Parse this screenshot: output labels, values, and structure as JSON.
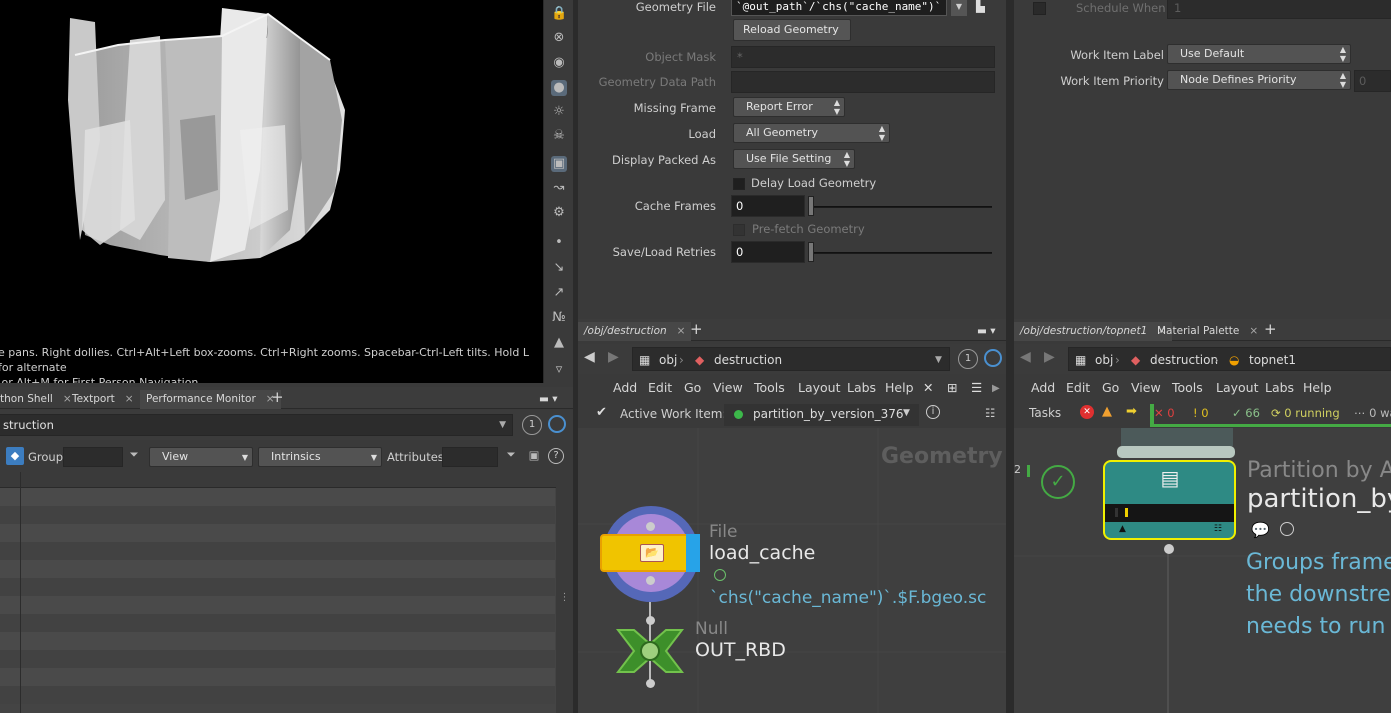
{
  "viewport": {
    "hint_text": "e pans. Right dollies. Ctrl+Alt+Left box-zooms. Ctrl+Right zooms. Spacebar-Ctrl-Left tilts. Hold L for alternate\n or Alt+M for First Person Navigation."
  },
  "lower_left": {
    "tabs": [
      {
        "label": "thon Shell"
      },
      {
        "label": "Textport"
      },
      {
        "label": "Performance Monitor"
      }
    ],
    "path_value": "struction",
    "group_label": "Group:",
    "view_label": "View",
    "intrinsics_label": "Intrinsics",
    "attributes_label": "Attributes:",
    "badge": "1"
  },
  "params": {
    "geometry_file_label": "Geometry File",
    "geometry_file_value": "`@out_path`/`chs(\"cache_name\")`",
    "reload_label": "Reload Geometry",
    "object_mask_label": "Object Mask",
    "object_mask_value": "*",
    "geo_data_path_label": "Geometry Data Path",
    "missing_frame_label": "Missing Frame",
    "missing_frame_value": "Report Error",
    "load_label": "Load",
    "load_value": "All Geometry",
    "display_packed_label": "Display Packed As",
    "display_packed_value": "Use File Setting",
    "delay_load_label": "Delay Load Geometry",
    "cache_frames_label": "Cache Frames",
    "cache_frames_value": "0",
    "prefetch_label": "Pre-fetch Geometry",
    "retries_label": "Save/Load Retries",
    "retries_value": "0"
  },
  "right_params": {
    "schedule_when_label": "Schedule When",
    "schedule_when_value": "1",
    "work_item_label_label": "Work Item Label",
    "work_item_label_value": "Use Default",
    "work_item_priority_label": "Work Item Priority",
    "work_item_priority_value": "Node Defines Priority",
    "priority_num": "0"
  },
  "mid_network": {
    "tab_label": "/obj/destruction",
    "crumb_obj": "obj",
    "crumb_dest": "destruction",
    "badge": "1",
    "menu": [
      "Add",
      "Edit",
      "Go",
      "View",
      "Tools",
      "Layout",
      "Labs",
      "Help"
    ],
    "active_work_item_label": "Active Work Item:",
    "active_work_item_value": "partition_by_version_376",
    "context_label": "Geometry",
    "node1_type": "File",
    "node1_name": "load_cache",
    "node1_comment": "`chs(\"cache_name\")`.$F.bgeo.sc",
    "node2_type": "Null",
    "node2_name": "OUT_RBD"
  },
  "right_network": {
    "tabs": [
      {
        "label": "/obj/destruction/topnet1"
      },
      {
        "label": "Material Palette"
      }
    ],
    "crumb_obj": "obj",
    "crumb_dest": "destruction",
    "crumb_topnet": "topnet1",
    "menu": [
      "Add",
      "Edit",
      "Go",
      "View",
      "Tools",
      "Layout",
      "Labs",
      "Help"
    ],
    "tasks_label": "Tasks",
    "stat_errors": "0",
    "stat_warnings": "0",
    "stat_done": "66",
    "stat_running": "0 running",
    "stat_waiting": "0 wa",
    "row_number": "2",
    "node_type": "Partition by A",
    "node_name": "partition_by",
    "node_desc": "Groups frame\nthe downstre\nneeds to run o"
  },
  "colors": {
    "accent_blue": "#4a90d0",
    "node_yellow": "#f0c400",
    "node_teal": "#2e8a84",
    "comment_cyan": "#6ab8d6",
    "ok_green": "#44aa44",
    "err_red": "#e03030"
  }
}
